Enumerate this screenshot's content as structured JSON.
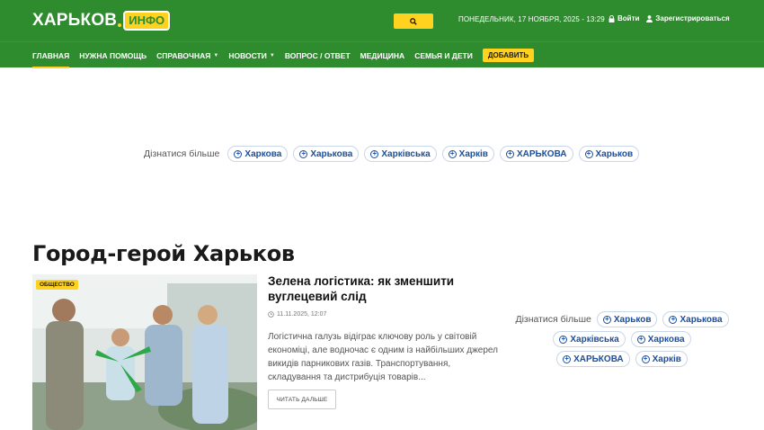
{
  "header": {
    "logo_text": "ХАРЬКОВ",
    "logo_badge": "ИНФО",
    "date": "ПОНЕДЕЛЬНИК, 17 НОЯБРЯ, 2025 - 13:29",
    "login": "Войти",
    "register": "Зарегистрироваться",
    "search_icon": "search-icon"
  },
  "nav": {
    "items": [
      {
        "label": "ГЛАВНАЯ"
      },
      {
        "label": "НУЖНА ПОМОЩЬ"
      },
      {
        "label": "СПРАВОЧНАЯ"
      },
      {
        "label": "НОВОСТИ"
      },
      {
        "label": "ВОПРОС / ОТВЕТ"
      },
      {
        "label": "МЕДИЦИНА"
      },
      {
        "label": "СЕМЬЯ И ДЕТИ"
      }
    ],
    "add_label": "ДОБАВИТЬ"
  },
  "tags_top": {
    "label": "Дізнатися більше",
    "items": [
      "Харкова",
      "Харькова",
      "Харківська",
      "Харків",
      "ХАРЬКОВА",
      "Харьков"
    ]
  },
  "section": {
    "title": "Город-герой Харьков"
  },
  "article": {
    "category": "ОБЩЕСТВО",
    "title": "Зелена логістика: як зменшити вуглецевий слід",
    "date": "11.11.2025, 12:07",
    "excerpt": "Логістична галузь відіграє ключову роль у світовій економіці, але водночас є одним із найбільших джерел викидів парникових газів. Транспортування, складування та дистрибуція товарів...",
    "read_more": "ЧИТАТЬ ДАЛЬШЕ"
  },
  "tags_side": {
    "label": "Дізнатися більше",
    "items": [
      "Харьков",
      "Харькова",
      "Харківська",
      "Харкова",
      "ХАРЬКОВА",
      "Харків"
    ]
  },
  "colors": {
    "brand_green": "#2e8b2e",
    "accent_yellow": "#ffd21f",
    "tag_blue": "#1a4fa0"
  }
}
